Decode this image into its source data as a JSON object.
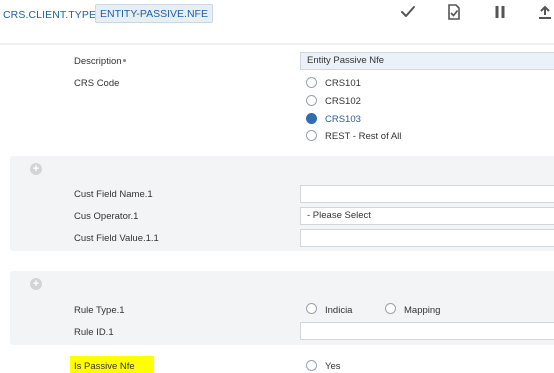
{
  "header": {
    "app_title": "CRS.CLIENT.TYPE",
    "record_id": "ENTITY-PASSIVE.NFE",
    "toolbar": [
      {
        "name": "commit-icon"
      },
      {
        "name": "validate-icon"
      },
      {
        "name": "hold-icon"
      },
      {
        "name": "upload-icon"
      }
    ]
  },
  "form": {
    "description_label": "Description",
    "description_value": "Entity Passive Nfe",
    "crs_code_label": "CRS Code",
    "crs_code_options": [
      "CRS101",
      "CRS102",
      "CRS103",
      "REST - Rest of All"
    ],
    "crs_code_selected": "CRS103",
    "is_passive_label": "Is Passive Nfe",
    "is_passive_option": "Yes"
  },
  "cust_group": {
    "field_name_label": "Cust Field Name.1",
    "field_name_value": "",
    "operator_label": "Cus Operator.1",
    "operator_value": "- Please Select",
    "field_value_label": "Cust Field Value.1.1",
    "field_value_value": ""
  },
  "rule_group": {
    "rule_type_label": "Rule Type.1",
    "rule_type_options": [
      "Indicia",
      "Mapping"
    ],
    "rule_id_label": "Rule ID.1",
    "rule_id_value": ""
  },
  "colors": {
    "accent": "#1f5fa8",
    "radio_selected": "#2f6db0",
    "highlight": "#ffff00",
    "panel_bg": "#f3f4f5"
  }
}
